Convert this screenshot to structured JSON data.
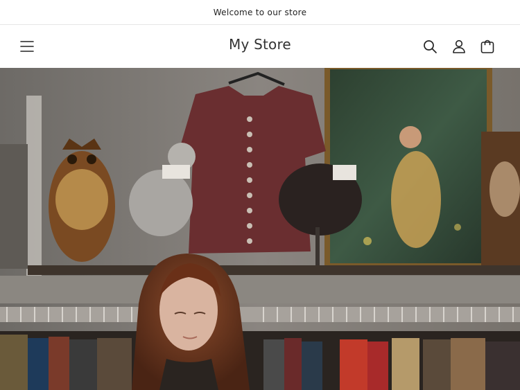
{
  "announcement": {
    "text": "Welcome to our store"
  },
  "header": {
    "store_name": "My Store",
    "icons": {
      "menu": "hamburger-menu-icon",
      "search": "search-icon",
      "account": "account-icon",
      "cart": "cart-icon"
    }
  },
  "hero": {
    "image": "thrift-store-photo"
  },
  "colors": {
    "text": "#1a1a1a",
    "border": "#e6e6e6",
    "background": "#ffffff"
  }
}
